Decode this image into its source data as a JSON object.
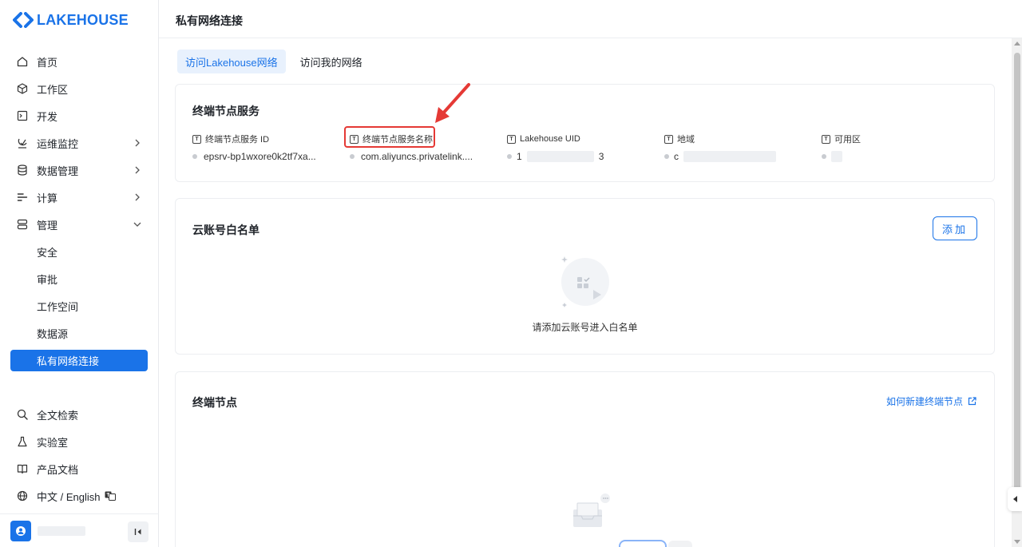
{
  "brand": {
    "name": "LAKEHOUSE",
    "color": "#1a73e8"
  },
  "header": {
    "title": "私有网络连接"
  },
  "sidebar": {
    "items": [
      {
        "label": "首页",
        "icon": "home-icon"
      },
      {
        "label": "工作区",
        "icon": "cube-icon"
      },
      {
        "label": "开发",
        "icon": "terminal-icon"
      },
      {
        "label": "运维监控",
        "icon": "monitor-icon",
        "has_children": true
      },
      {
        "label": "数据管理",
        "icon": "database-icon",
        "has_children": true
      },
      {
        "label": "计算",
        "icon": "compute-icon",
        "has_children": true
      },
      {
        "label": "管理",
        "icon": "server-icon",
        "expanded": true
      }
    ],
    "sub_items": [
      {
        "label": "安全"
      },
      {
        "label": "审批"
      },
      {
        "label": "工作空间"
      },
      {
        "label": "数据源"
      },
      {
        "label": "私有网络连接",
        "active": true
      }
    ],
    "bottom_items": [
      {
        "label": "全文检索",
        "icon": "search-icon"
      },
      {
        "label": "实验室",
        "icon": "flask-icon"
      },
      {
        "label": "产品文档",
        "icon": "book-icon"
      },
      {
        "label": "中文 / English",
        "icon": "globe-icon"
      }
    ]
  },
  "tabs": [
    {
      "label": "访问Lakehouse网络",
      "active": true
    },
    {
      "label": "访问我的网络",
      "active": false
    }
  ],
  "endpoint_service": {
    "title": "终端节点服务",
    "fields": [
      {
        "label": "终端节点服务 ID",
        "value": "epsrv-bp1wxore0k2tf7xa..."
      },
      {
        "label": "终端节点服务名称",
        "value": "com.aliyuncs.privatelink...."
      },
      {
        "label": "Lakehouse UID",
        "value_start": "1",
        "value_end": "3"
      },
      {
        "label": "地域",
        "value_start": "c",
        "value_end": ""
      },
      {
        "label": "可用区",
        "value_start": "",
        "value_end": ""
      }
    ],
    "label_icon_text": "T"
  },
  "whitelist": {
    "title": "云账号白名单",
    "add_label": "添加",
    "empty_text": "请添加云账号进入白名单"
  },
  "endpoints": {
    "title": "终端节点",
    "help_link": "如何新建终端节点"
  },
  "colors": {
    "accent": "#1a73e8",
    "highlight": "#e53935"
  }
}
